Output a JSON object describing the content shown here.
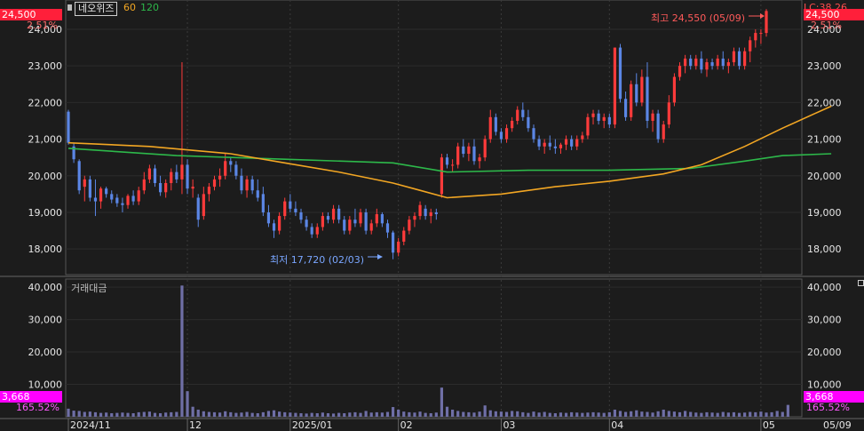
{
  "header": {
    "stock_name": "네오위즈",
    "ma_labels": [
      "60",
      "120"
    ],
    "lc_label": "LC:38.26"
  },
  "price_box": {
    "value": "24,500",
    "pct": "2.51%"
  },
  "volume_box": {
    "value": "3,668",
    "pct": "165.52%"
  },
  "volume_title": "거래대금",
  "annotations": {
    "high": "최고 24,550 (05/09)",
    "low": "최저 17,720 (02/03)"
  },
  "x_labels": [
    "2024/11",
    "12",
    "2025/01",
    "02",
    "03",
    "04",
    "05",
    "05/09"
  ],
  "colors": {
    "up": "#ff3b3b",
    "down": "#5b86e5",
    "ma60": "#f2a623",
    "ma120": "#2db84a",
    "volume": "#6f6fa6",
    "price_box": "#ff1f3a",
    "volume_box": "#ff00ff"
  },
  "chart_data": [
    {
      "type": "candlestick",
      "title": "네오위즈",
      "y_ticks": [
        "18,000",
        "19,000",
        "20,000",
        "21,000",
        "22,000",
        "23,000",
        "24,000"
      ],
      "ylim": [
        17300,
        24800
      ],
      "x_range": [
        "2024-11-01",
        "2025-05-09"
      ],
      "daily_ohlc": [
        [
          21750,
          21800,
          20850,
          20900
        ],
        [
          20800,
          20900,
          20350,
          20450
        ],
        [
          20400,
          20450,
          19500,
          19600
        ],
        [
          19700,
          20000,
          19300,
          19900
        ],
        [
          19900,
          20000,
          19300,
          19400
        ],
        [
          19400,
          19900,
          18900,
          19300
        ],
        [
          19300,
          19700,
          19100,
          19650
        ],
        [
          19650,
          19700,
          19400,
          19500
        ],
        [
          19500,
          19600,
          19250,
          19350
        ],
        [
          19400,
          19500,
          19150,
          19250
        ],
        [
          19250,
          19400,
          19000,
          19200
        ],
        [
          19200,
          19500,
          19100,
          19450
        ],
        [
          19450,
          19600,
          19200,
          19300
        ],
        [
          19300,
          19700,
          19200,
          19600
        ],
        [
          19600,
          20100,
          19500,
          19900
        ],
        [
          19900,
          20300,
          19800,
          20200
        ],
        [
          20200,
          20300,
          19700,
          19800
        ],
        [
          19800,
          20000,
          19450,
          19550
        ],
        [
          19550,
          19900,
          19400,
          19800
        ],
        [
          19800,
          20200,
          19600,
          20100
        ],
        [
          20100,
          20300,
          19800,
          19900
        ],
        [
          19900,
          23100,
          19500,
          20300
        ],
        [
          20300,
          20450,
          19500,
          19650
        ],
        [
          19650,
          19900,
          19400,
          19700
        ],
        [
          19400,
          19500,
          18600,
          18800
        ],
        [
          18900,
          19700,
          18800,
          19500
        ],
        [
          19500,
          19800,
          19300,
          19700
        ],
        [
          19700,
          20000,
          19600,
          19900
        ],
        [
          19900,
          20200,
          19700,
          20000
        ],
        [
          20000,
          20600,
          19900,
          20400
        ],
        [
          20400,
          20500,
          20100,
          20300
        ],
        [
          20300,
          20400,
          19900,
          20000
        ],
        [
          20000,
          20200,
          19500,
          19600
        ],
        [
          19600,
          20000,
          19400,
          19900
        ],
        [
          19900,
          20000,
          19500,
          19600
        ],
        [
          19600,
          19900,
          19300,
          19400
        ],
        [
          19500,
          19700,
          18900,
          19000
        ],
        [
          19000,
          19200,
          18600,
          18700
        ],
        [
          18700,
          18800,
          18300,
          18500
        ],
        [
          18500,
          19000,
          18400,
          18900
        ],
        [
          18900,
          19400,
          18800,
          19300
        ],
        [
          19300,
          19500,
          19000,
          19100
        ],
        [
          19100,
          19300,
          18900,
          19000
        ],
        [
          19000,
          19100,
          18700,
          18800
        ],
        [
          18800,
          18900,
          18500,
          18600
        ],
        [
          18600,
          18700,
          18300,
          18400
        ],
        [
          18400,
          18700,
          18300,
          18600
        ],
        [
          18600,
          19000,
          18500,
          18900
        ],
        [
          18900,
          19000,
          18700,
          18800
        ],
        [
          18800,
          19200,
          18700,
          19100
        ],
        [
          19100,
          19200,
          18700,
          18800
        ],
        [
          18800,
          18900,
          18400,
          18500
        ],
        [
          18500,
          18900,
          18400,
          18800
        ],
        [
          18800,
          19100,
          18600,
          18700
        ],
        [
          18700,
          19100,
          18600,
          19000
        ],
        [
          19000,
          19100,
          18400,
          18500
        ],
        [
          18500,
          18800,
          18400,
          18700
        ],
        [
          18700,
          19100,
          18600,
          18950
        ],
        [
          18950,
          19000,
          18600,
          18700
        ],
        [
          18700,
          18800,
          18300,
          18450
        ],
        [
          18450,
          18500,
          17720,
          17900
        ],
        [
          17900,
          18300,
          17800,
          18200
        ],
        [
          18200,
          18600,
          18100,
          18500
        ],
        [
          18500,
          18900,
          18400,
          18800
        ],
        [
          18800,
          19000,
          18600,
          18900
        ],
        [
          18900,
          19300,
          18800,
          19200
        ],
        [
          19100,
          19200,
          18800,
          18900
        ],
        [
          18900,
          19100,
          18700,
          19000
        ],
        [
          19000,
          19100,
          18800,
          18950
        ],
        [
          19500,
          20600,
          19400,
          20500
        ],
        [
          20500,
          20600,
          20200,
          20300
        ],
        [
          20300,
          20450,
          20100,
          20300
        ],
        [
          20300,
          20900,
          20200,
          20800
        ],
        [
          20800,
          21000,
          20500,
          20600
        ],
        [
          20600,
          20900,
          20400,
          20800
        ],
        [
          20800,
          21000,
          20300,
          20400
        ],
        [
          20400,
          20600,
          20200,
          20500
        ],
        [
          20500,
          21100,
          20400,
          21000
        ],
        [
          21000,
          21800,
          20900,
          21600
        ],
        [
          21600,
          21700,
          21100,
          21200
        ],
        [
          21200,
          21300,
          20900,
          21000
        ],
        [
          21000,
          21400,
          20900,
          21300
        ],
        [
          21300,
          21600,
          21200,
          21500
        ],
        [
          21500,
          21900,
          21400,
          21800
        ],
        [
          21800,
          22000,
          21500,
          21600
        ],
        [
          21600,
          21800,
          21200,
          21300
        ],
        [
          21300,
          21400,
          20900,
          21000
        ],
        [
          21000,
          21100,
          20700,
          20800
        ],
        [
          20800,
          21000,
          20600,
          20900
        ],
        [
          20900,
          21100,
          20700,
          20800
        ],
        [
          20800,
          21000,
          20600,
          20750
        ],
        [
          20750,
          20900,
          20600,
          20850
        ],
        [
          20850,
          21100,
          20700,
          21000
        ],
        [
          21000,
          21100,
          20700,
          20800
        ],
        [
          20800,
          21100,
          20700,
          21000
        ],
        [
          21000,
          21200,
          20900,
          21100
        ],
        [
          21100,
          21700,
          21000,
          21600
        ],
        [
          21600,
          21800,
          21400,
          21700
        ],
        [
          21700,
          21800,
          21400,
          21500
        ],
        [
          21500,
          21700,
          21300,
          21600
        ],
        [
          21600,
          21700,
          21300,
          21400
        ],
        [
          21400,
          23500,
          21300,
          23500
        ],
        [
          23500,
          23600,
          22000,
          22100
        ],
        [
          22100,
          22300,
          21500,
          21600
        ],
        [
          21600,
          22600,
          21500,
          22500
        ],
        [
          22500,
          22800,
          21900,
          22000
        ],
        [
          22000,
          22900,
          21900,
          22700
        ],
        [
          22700,
          23100,
          21300,
          21500
        ],
        [
          21500,
          21800,
          21200,
          21700
        ],
        [
          21700,
          21800,
          20900,
          21000
        ],
        [
          21000,
          21500,
          20900,
          21400
        ],
        [
          21400,
          22200,
          21300,
          22000
        ],
        [
          22000,
          22800,
          21900,
          22700
        ],
        [
          22700,
          23100,
          22600,
          23000
        ],
        [
          23000,
          23300,
          22800,
          23200
        ],
        [
          23200,
          23300,
          22900,
          23000
        ],
        [
          23000,
          23300,
          22900,
          23200
        ],
        [
          23200,
          23400,
          22800,
          22900
        ],
        [
          22900,
          23200,
          22700,
          23100
        ],
        [
          23100,
          23200,
          22900,
          23000
        ],
        [
          23000,
          23300,
          22900,
          23200
        ],
        [
          23200,
          23400,
          22900,
          23000
        ],
        [
          23000,
          23200,
          22800,
          23100
        ],
        [
          23100,
          23500,
          23000,
          23400
        ],
        [
          23400,
          23500,
          22900,
          23000
        ],
        [
          23000,
          23500,
          22900,
          23400
        ],
        [
          23400,
          23800,
          23100,
          23700
        ],
        [
          23700,
          24000,
          23500,
          23900
        ],
        [
          23900,
          24000,
          23600,
          23900
        ],
        [
          23900,
          24550,
          23800,
          24500
        ]
      ],
      "ma60": [
        [
          0,
          20900
        ],
        [
          15,
          20800
        ],
        [
          30,
          20600
        ],
        [
          40,
          20350
        ],
        [
          50,
          20100
        ],
        [
          60,
          19800
        ],
        [
          65,
          19600
        ],
        [
          70,
          19400
        ],
        [
          80,
          19500
        ],
        [
          90,
          19700
        ],
        [
          100,
          19850
        ],
        [
          110,
          20050
        ],
        [
          117,
          20300
        ],
        [
          125,
          20800
        ],
        [
          132,
          21300
        ],
        [
          138,
          21700
        ],
        [
          141,
          21900
        ]
      ],
      "ma120": [
        [
          0,
          20750
        ],
        [
          20,
          20550
        ],
        [
          40,
          20450
        ],
        [
          60,
          20350
        ],
        [
          70,
          20100
        ],
        [
          85,
          20150
        ],
        [
          100,
          20150
        ],
        [
          115,
          20200
        ],
        [
          125,
          20400
        ],
        [
          132,
          20550
        ],
        [
          141,
          20600
        ]
      ]
    },
    {
      "type": "bar",
      "title": "거래대금",
      "y_ticks": [
        "10,000",
        "20,000",
        "30,000",
        "40,000"
      ],
      "ylim": [
        0,
        42500
      ],
      "values": [
        2500,
        1900,
        1800,
        1500,
        1600,
        1400,
        1200,
        1300,
        1100,
        1200,
        1300,
        1200,
        1100,
        1400,
        1500,
        1600,
        1200,
        1100,
        1300,
        1400,
        1500,
        40500,
        7900,
        3100,
        2200,
        1700,
        1500,
        1400,
        1300,
        1700,
        1400,
        1200,
        1300,
        1500,
        1200,
        1100,
        1400,
        1800,
        2000,
        1600,
        1400,
        1300,
        1200,
        1100,
        1000,
        1200,
        1100,
        1300,
        1100,
        1000,
        1200,
        1100,
        1300,
        1400,
        1200,
        1800,
        1300,
        1400,
        1300,
        1500,
        3000,
        2200,
        1600,
        1400,
        1300,
        1600,
        1200,
        1100,
        1300,
        9000,
        3100,
        2200,
        1800,
        1500,
        1400,
        1300,
        1600,
        3500,
        2000,
        1700,
        1600,
        1500,
        1800,
        1700,
        1400,
        1200,
        1600,
        1300,
        1500,
        1200,
        1100,
        1300,
        1200,
        1400,
        1300,
        1200,
        1300,
        1400,
        1300,
        1200,
        1400,
        2200,
        1800,
        1500,
        1700,
        2000,
        1600,
        1500,
        1300,
        1700,
        2200,
        1800,
        1600,
        1400,
        1800,
        1500,
        1300,
        1200,
        1400,
        1300,
        1200,
        1500,
        1300,
        1400,
        1200,
        1300,
        1500,
        1400,
        1600,
        1300,
        1400,
        1800,
        1500,
        3668
      ]
    }
  ]
}
